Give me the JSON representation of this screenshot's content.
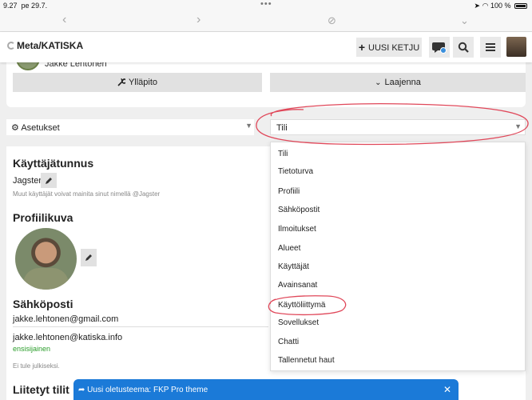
{
  "status_bar": {
    "time": "9.27",
    "date": "pe 29.7.",
    "battery": "100 %"
  },
  "header": {
    "site_title": "Meta/KATISKA",
    "new_topic_label": "UUSI KETJU"
  },
  "user_card": {
    "name": "Jakke Lehtonen",
    "admin_label": "Ylläpito",
    "expand_label": "Laajenna"
  },
  "selects": {
    "left_value": "Asetukset",
    "right_value": "Tili"
  },
  "settings": {
    "username_heading": "Käyttäjätunnus",
    "username_value": "Jagster",
    "username_hint": "Muut käyttäjät voivat mainita sinut nimellä @Jagster",
    "picture_heading": "Profiilikuva",
    "email_heading": "Sähköposti",
    "email_1": "jakke.lehtonen@gmail.com",
    "email_2": "jakke.lehtonen@katiska.info",
    "email_2_badge": "ensisijainen",
    "email_hint": "Ei tule julkiseksi.",
    "linked_heading": "Liitetyt tilit"
  },
  "dropdown": {
    "items": [
      "Tili",
      "Tietoturva",
      "Profiili",
      "Sähköpostit",
      "Ilmoitukset",
      "Alueet",
      "Käyttäjät",
      "Avainsanat",
      "Käyttöliittymä",
      "Sovellukset",
      "Chatti",
      "Tallennetut haut"
    ]
  },
  "toast": {
    "message": "Uusi oletusteema: FKP Pro theme",
    "close": "✕"
  },
  "colors": {
    "accent": "#1b7ad8",
    "annotation": "#e0485a",
    "success": "#2a9d2a"
  }
}
